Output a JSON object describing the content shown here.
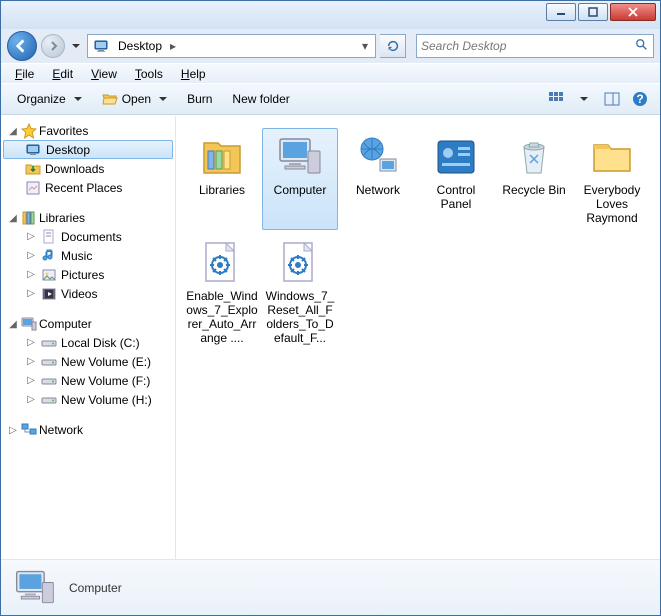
{
  "titlebar": {},
  "address": {
    "location": "Desktop",
    "crumb_sep": "▸"
  },
  "search": {
    "placeholder": "Search Desktop"
  },
  "menubar": {
    "file": "File",
    "edit": "Edit",
    "view": "View",
    "tools": "Tools",
    "help": "Help"
  },
  "toolbar": {
    "organize": "Organize",
    "open": "Open",
    "burn": "Burn",
    "newfolder": "New folder"
  },
  "tree": {
    "favorites": {
      "label": "Favorites",
      "items": [
        {
          "label": "Desktop",
          "selected": true
        },
        {
          "label": "Downloads"
        },
        {
          "label": "Recent Places"
        }
      ]
    },
    "libraries": {
      "label": "Libraries",
      "items": [
        {
          "label": "Documents"
        },
        {
          "label": "Music"
        },
        {
          "label": "Pictures"
        },
        {
          "label": "Videos"
        }
      ]
    },
    "computer": {
      "label": "Computer",
      "items": [
        {
          "label": "Local Disk (C:)"
        },
        {
          "label": "New Volume (E:)"
        },
        {
          "label": "New Volume (F:)"
        },
        {
          "label": "New Volume (H:)"
        }
      ]
    },
    "network": {
      "label": "Network"
    }
  },
  "items": [
    {
      "label": "Libraries",
      "kind": "libraries"
    },
    {
      "label": "Computer",
      "kind": "computer",
      "selected": true
    },
    {
      "label": "Network",
      "kind": "network"
    },
    {
      "label": "Control Panel",
      "kind": "cpanel"
    },
    {
      "label": "Recycle Bin",
      "kind": "recycle"
    },
    {
      "label": "Everybody Loves Raymond",
      "kind": "folder"
    },
    {
      "label": "Enable_Windows_7_Explorer_Auto_Arrange ....",
      "kind": "regfile"
    },
    {
      "label": "Windows_7_Reset_All_Folders_To_Default_F...",
      "kind": "regfile"
    }
  ],
  "details": {
    "name": "Computer"
  }
}
